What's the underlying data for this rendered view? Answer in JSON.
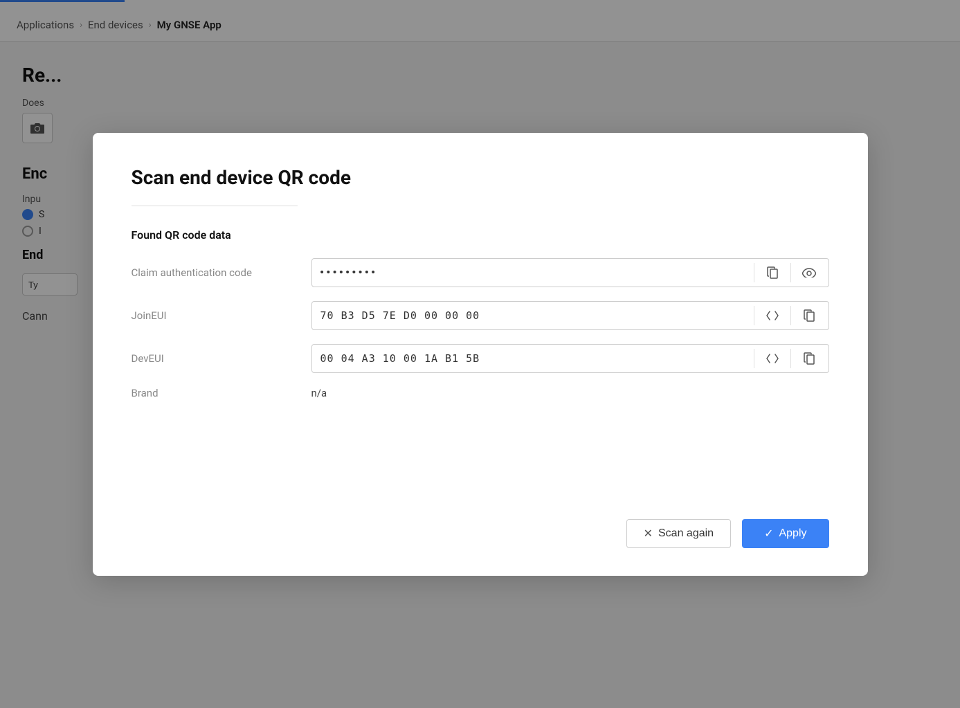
{
  "breadcrumb": {
    "items": [
      "Applications",
      "End devices",
      "My GNSE App"
    ],
    "separator": "›"
  },
  "background": {
    "page_title": "Re...",
    "does_label": "Does",
    "enc_label": "Enc",
    "input_label": "Inpu",
    "end_label": "End",
    "type_placeholder": "Ty",
    "cannot_label": "Cann"
  },
  "modal": {
    "title": "Scan end device QR code",
    "divider": true,
    "section_label": "Found QR code data",
    "fields": [
      {
        "label": "Claim authentication code",
        "type": "password",
        "value": "••••••••",
        "placeholder": "••••••••",
        "has_copy": true,
        "has_eye": true,
        "has_code": false
      },
      {
        "label": "JoinEUI",
        "type": "text",
        "value": "70 B3 D5 7E D0 00 00 00",
        "has_copy": true,
        "has_eye": false,
        "has_code": true
      },
      {
        "label": "DevEUI",
        "type": "text",
        "value": "00 04 A3 10 00 1A B1 5B",
        "has_copy": true,
        "has_eye": false,
        "has_code": true
      }
    ],
    "brand_label": "Brand",
    "brand_value": "n/a",
    "footer": {
      "scan_again_label": "Scan again",
      "apply_label": "Apply"
    }
  }
}
